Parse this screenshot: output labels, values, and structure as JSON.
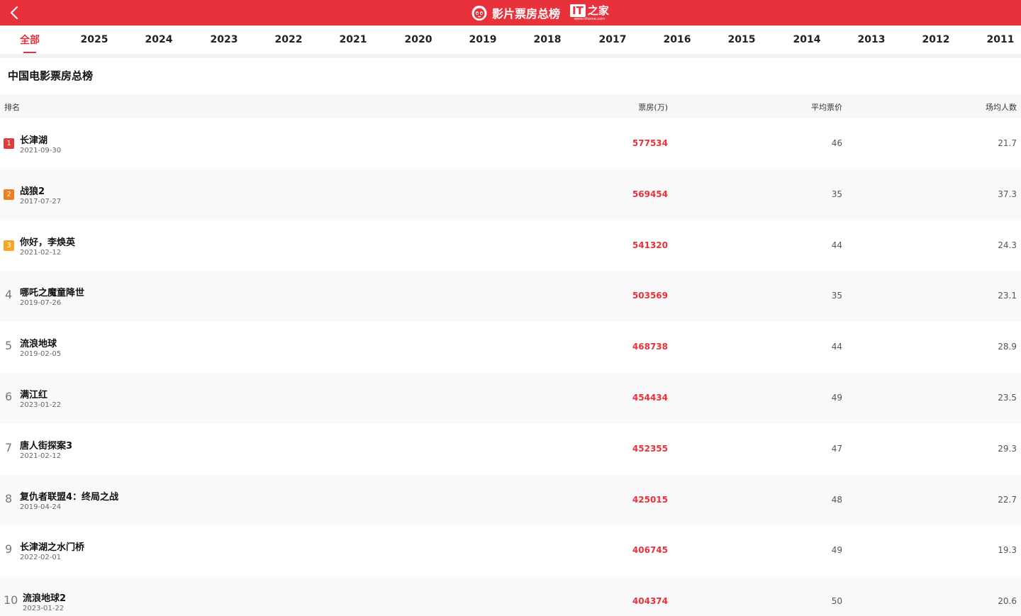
{
  "header": {
    "title": "影片票房总榜",
    "partner_logo_text": "IT",
    "partner_logo_cn": "之家",
    "partner_url": "www.ithome.com",
    "accent_color": "#e8313a"
  },
  "tabs": [
    "全部",
    "2025",
    "2024",
    "2023",
    "2022",
    "2021",
    "2020",
    "2019",
    "2018",
    "2017",
    "2016",
    "2015",
    "2014",
    "2013",
    "2012",
    "2011"
  ],
  "active_tab": "全部",
  "page_title": "中国电影票房总榜",
  "columns": {
    "rank": "排名",
    "box_office": "票房(万)",
    "avg_price": "平均票价",
    "avg_attendance": "场均人数"
  },
  "rank_badge_colors": [
    "#e23b3b",
    "#f07d1e",
    "#f5a623"
  ],
  "rows": [
    {
      "rank": "1",
      "title": "长津湖",
      "date": "2021-09-30",
      "box_office": "577534",
      "avg_price": "46",
      "avg_attendance": "21.7"
    },
    {
      "rank": "2",
      "title": "战狼2",
      "date": "2017-07-27",
      "box_office": "569454",
      "avg_price": "35",
      "avg_attendance": "37.3"
    },
    {
      "rank": "3",
      "title": "你好，李焕英",
      "date": "2021-02-12",
      "box_office": "541320",
      "avg_price": "44",
      "avg_attendance": "24.3"
    },
    {
      "rank": "4",
      "title": "哪吒之魔童降世",
      "date": "2019-07-26",
      "box_office": "503569",
      "avg_price": "35",
      "avg_attendance": "23.1"
    },
    {
      "rank": "5",
      "title": "流浪地球",
      "date": "2019-02-05",
      "box_office": "468738",
      "avg_price": "44",
      "avg_attendance": "28.9"
    },
    {
      "rank": "6",
      "title": "满江红",
      "date": "2023-01-22",
      "box_office": "454434",
      "avg_price": "49",
      "avg_attendance": "23.5"
    },
    {
      "rank": "7",
      "title": "唐人街探案3",
      "date": "2021-02-12",
      "box_office": "452355",
      "avg_price": "47",
      "avg_attendance": "29.3"
    },
    {
      "rank": "8",
      "title": "复仇者联盟4：终局之战",
      "date": "2019-04-24",
      "box_office": "425015",
      "avg_price": "48",
      "avg_attendance": "22.7"
    },
    {
      "rank": "9",
      "title": "长津湖之水门桥",
      "date": "2022-02-01",
      "box_office": "406745",
      "avg_price": "49",
      "avg_attendance": "19.3"
    },
    {
      "rank": "10",
      "title": "流浪地球2",
      "date": "2023-01-22",
      "box_office": "404374",
      "avg_price": "50",
      "avg_attendance": "20.6"
    }
  ]
}
